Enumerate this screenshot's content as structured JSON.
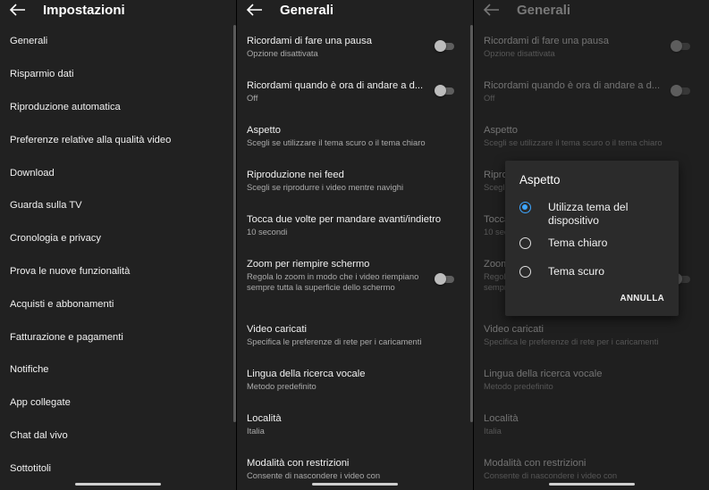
{
  "panel1": {
    "title": "Impostazioni",
    "items": [
      "Generali",
      "Risparmio dati",
      "Riproduzione automatica",
      "Preferenze relative alla qualità video",
      "Download",
      "Guarda sulla TV",
      "Cronologia e privacy",
      "Prova le nuove funzionalità",
      "Acquisti e abbonamenti",
      "Fatturazione e pagamenti",
      "Notifiche",
      "App collegate",
      "Chat dal vivo",
      "Sottotitoli"
    ]
  },
  "general": {
    "title": "Generali",
    "items": [
      {
        "title": "Ricordami di fare una pausa",
        "subtitle": "Opzione disattivata",
        "toggle": false
      },
      {
        "title": "Ricordami quando è ora di andare a d...",
        "subtitle": "Off",
        "toggle": false
      },
      {
        "title": "Aspetto",
        "subtitle": "Scegli se utilizzare il tema scuro o il tema chiaro"
      },
      {
        "title": "Riproduzione nei feed",
        "subtitle": "Scegli se riprodurre i video mentre navighi"
      },
      {
        "title": "Tocca due volte per mandare avanti/indietro",
        "subtitle": "10 secondi"
      },
      {
        "title": "Zoom per riempire schermo",
        "subtitle": "Regola lo zoom in modo che i video riempiano sempre tutta la superficie dello schermo",
        "toggle": false
      },
      {
        "title": "Video caricati",
        "subtitle": "Specifica le preferenze di rete per i caricamenti"
      },
      {
        "title": "Lingua della ricerca vocale",
        "subtitle": "Metodo predefinito"
      },
      {
        "title": "Località",
        "subtitle": "Italia"
      },
      {
        "title": "Modalità con restrizioni",
        "subtitle": "Consente di nascondere i video con"
      }
    ]
  },
  "dialog": {
    "title": "Aspetto",
    "options": [
      {
        "label": "Utilizza tema del dispositivo",
        "selected": true
      },
      {
        "label": "Tema chiaro",
        "selected": false
      },
      {
        "label": "Tema scuro",
        "selected": false
      }
    ],
    "cancel": "ANNULLA"
  },
  "colors": {
    "background": "#212121",
    "accent": "#3ea6ff",
    "secondary_text": "#aaaaaa"
  }
}
